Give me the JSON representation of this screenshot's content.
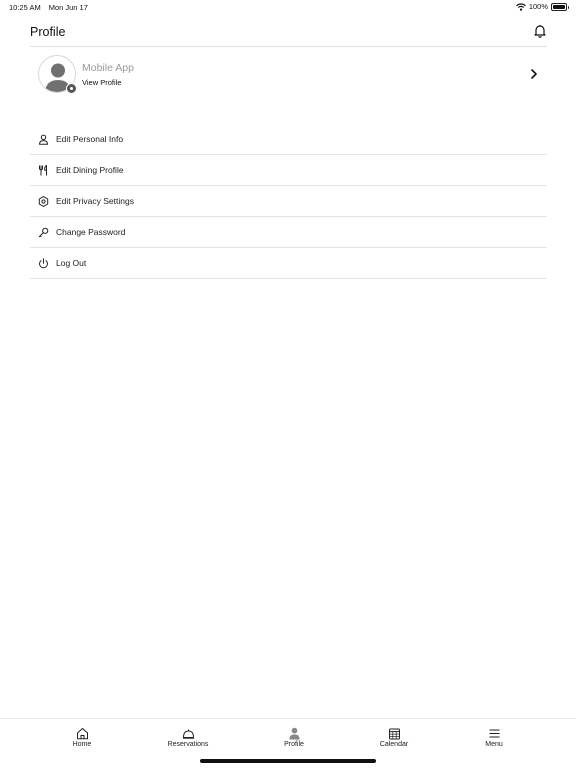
{
  "status_bar": {
    "time": "10:25 AM",
    "date": "Mon Jun 17",
    "battery": "100%",
    "battery_level": 1.0
  },
  "header": {
    "title": "Profile",
    "bell_icon": "bell-icon"
  },
  "profile": {
    "name": "Mobile App",
    "link": "View Profile",
    "avatar_icon": "person-avatar-icon",
    "camera_icon": "camera-badge-icon",
    "chevron_icon": "chevron-right-icon"
  },
  "menu": [
    {
      "label": "Edit Personal Info",
      "icon": "person-icon"
    },
    {
      "label": "Edit Dining Profile",
      "icon": "fork-knife-icon"
    },
    {
      "label": "Edit Privacy Settings",
      "icon": "gear-icon"
    },
    {
      "label": "Change Password",
      "icon": "key-icon"
    },
    {
      "label": "Log Out",
      "icon": "power-icon"
    }
  ],
  "tabs": [
    {
      "label": "Home",
      "icon": "home-icon",
      "active": false
    },
    {
      "label": "Reservations",
      "icon": "cloche-icon",
      "active": false
    },
    {
      "label": "Profile",
      "icon": "person-filled-icon",
      "active": true
    },
    {
      "label": "Calendar",
      "icon": "calendar-icon",
      "active": false
    },
    {
      "label": "Menu",
      "icon": "hamburger-icon",
      "active": false
    }
  ],
  "colors": {
    "background": "#ffffff",
    "text": "#111111",
    "muted_text": "#9a9a9a",
    "divider": "#e4e4e4",
    "icon_active": "#888888"
  }
}
